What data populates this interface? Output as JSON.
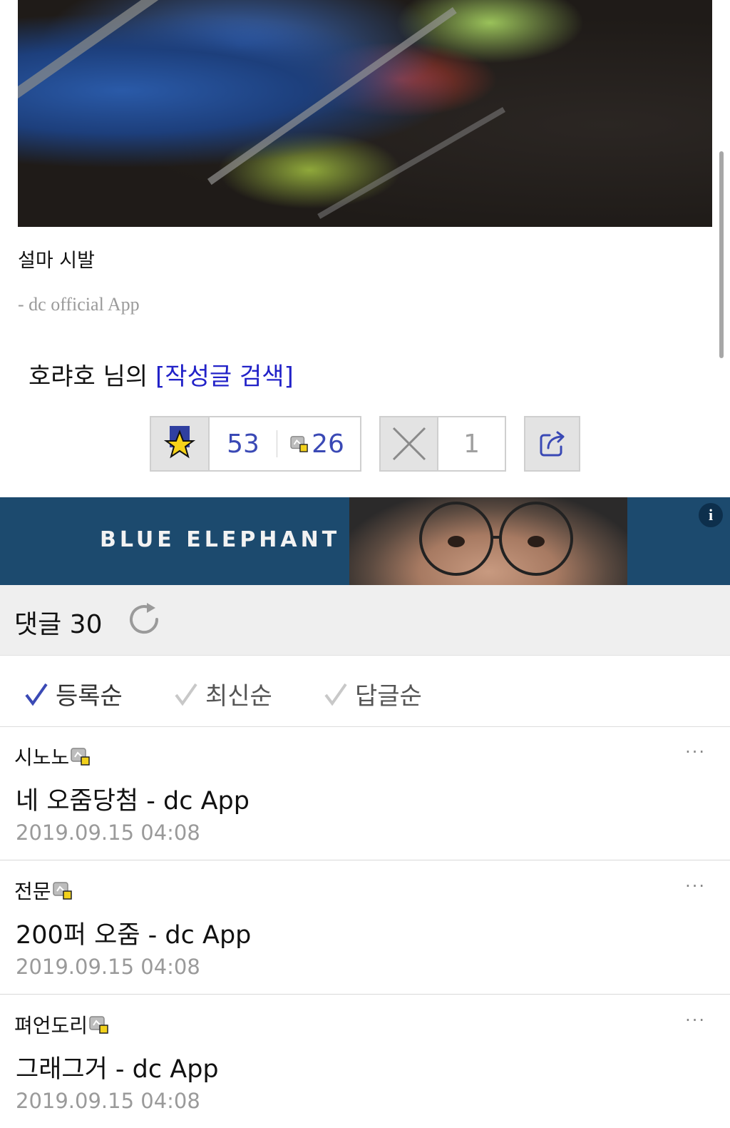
{
  "post": {
    "body_text": "설마 시발",
    "signature": "- dc official App",
    "author_nick": "호랴호",
    "author_suffix": " 님의 ",
    "search_link": "[작성글 검색]"
  },
  "votes": {
    "recommend_count": "53",
    "fixed_recommend_count": "26",
    "not_recommend_count": "1"
  },
  "banner": {
    "brand": "BLUE ELEPHANT",
    "info_label": "i"
  },
  "comments": {
    "title": "댓글 30",
    "sort_options": [
      {
        "label": "등록순",
        "active": true
      },
      {
        "label": "최신순",
        "active": false
      },
      {
        "label": "답글순",
        "active": false
      }
    ],
    "items": [
      {
        "nick": "시노노",
        "body": "네 오줌당첨 - dc App",
        "date": "2019.09.15 04:08",
        "more": "···"
      },
      {
        "nick": "전문",
        "body": "200퍼 오줌  - dc App",
        "date": "2019.09.15 04:08",
        "more": "···"
      },
      {
        "nick": "펴언도리",
        "body": "그래그거 - dc App",
        "date": "2019.09.15 04:08",
        "more": "···"
      }
    ]
  },
  "icons": [
    "star-icon",
    "gallery-badge-icon",
    "x-icon",
    "share-icon",
    "refresh-icon",
    "check-icon",
    "more-icon",
    "info-icon"
  ],
  "colors": {
    "accent_blue": "#3a49b5",
    "link_blue": "#2222c8",
    "banner_bg": "#1c4a6e"
  }
}
